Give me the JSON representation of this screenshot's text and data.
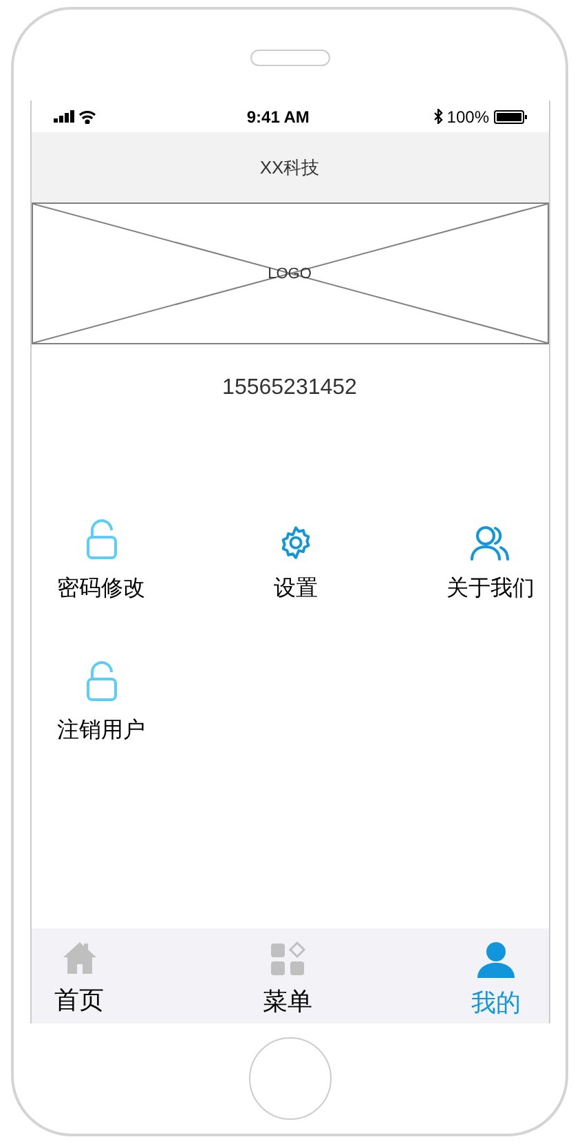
{
  "status_bar": {
    "time": "9:41 AM",
    "battery": "100%"
  },
  "header": {
    "title": "XX科技"
  },
  "logo": {
    "label": "LOGO"
  },
  "phone_number": "15565231452",
  "menu": [
    {
      "kind": "lock",
      "label": "密码修改"
    },
    {
      "kind": "gear",
      "label": "设置"
    },
    {
      "kind": "users",
      "label": "关于我们"
    },
    {
      "kind": "lock",
      "label": "注销用户"
    }
  ],
  "tabs": [
    {
      "kind": "home",
      "label": "首页",
      "selected": false
    },
    {
      "kind": "apps",
      "label": "菜单",
      "selected": false
    },
    {
      "kind": "user",
      "label": "我的",
      "selected": true
    }
  ]
}
